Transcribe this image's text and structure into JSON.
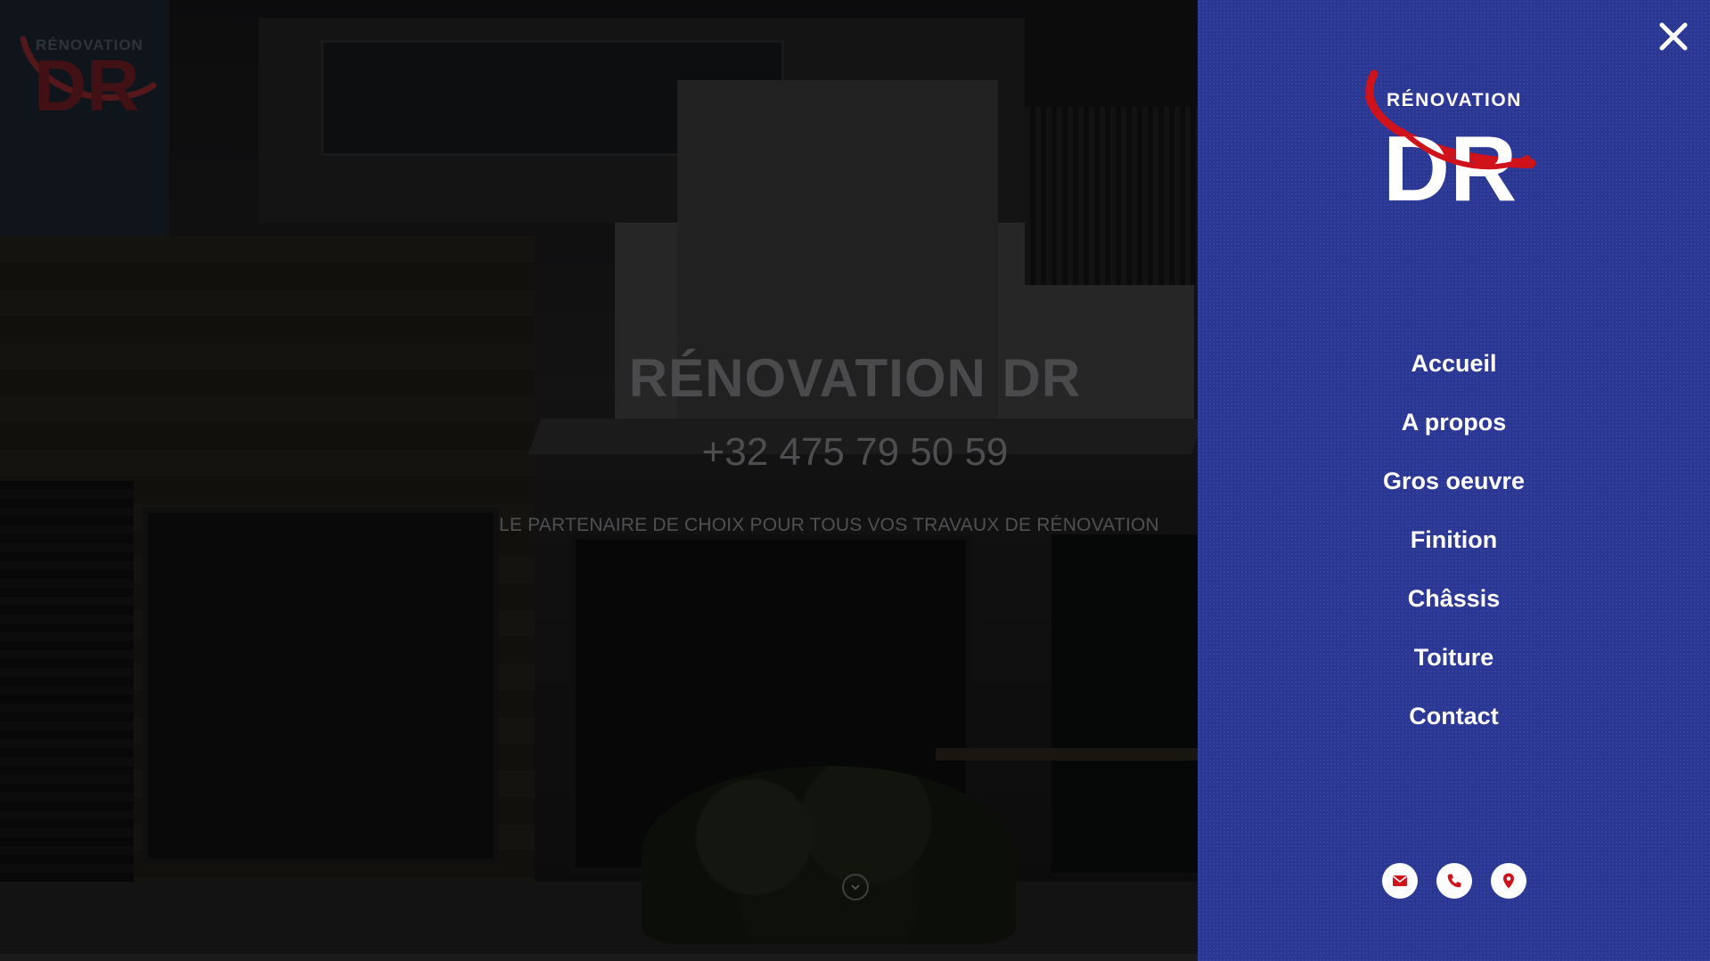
{
  "hero": {
    "title": "RÉNOVATION DR",
    "phone": "+32 475 79 50 59",
    "tagline": "LE PARTENAIRE DE CHOIX POUR TOUS VOS TRAVAUX DE RÉNOVATION",
    "scroll_icon": "chevron-down-icon"
  },
  "logo": {
    "brand_word": "RÉNOVATION",
    "brand_letters": "DR"
  },
  "menu": {
    "items": [
      {
        "label": "Accueil"
      },
      {
        "label": "A propos"
      },
      {
        "label": "Gros oeuvre"
      },
      {
        "label": "Finition"
      },
      {
        "label": "Châssis"
      },
      {
        "label": "Toiture"
      },
      {
        "label": "Contact"
      }
    ],
    "close_icon": "close-icon"
  },
  "contact_icons": [
    "envelope-icon",
    "phone-icon",
    "map-pin-icon"
  ],
  "colors": {
    "panel_bg": "#2b3795",
    "accent_red": "#d0121b",
    "menu_text": "#ffffff"
  }
}
